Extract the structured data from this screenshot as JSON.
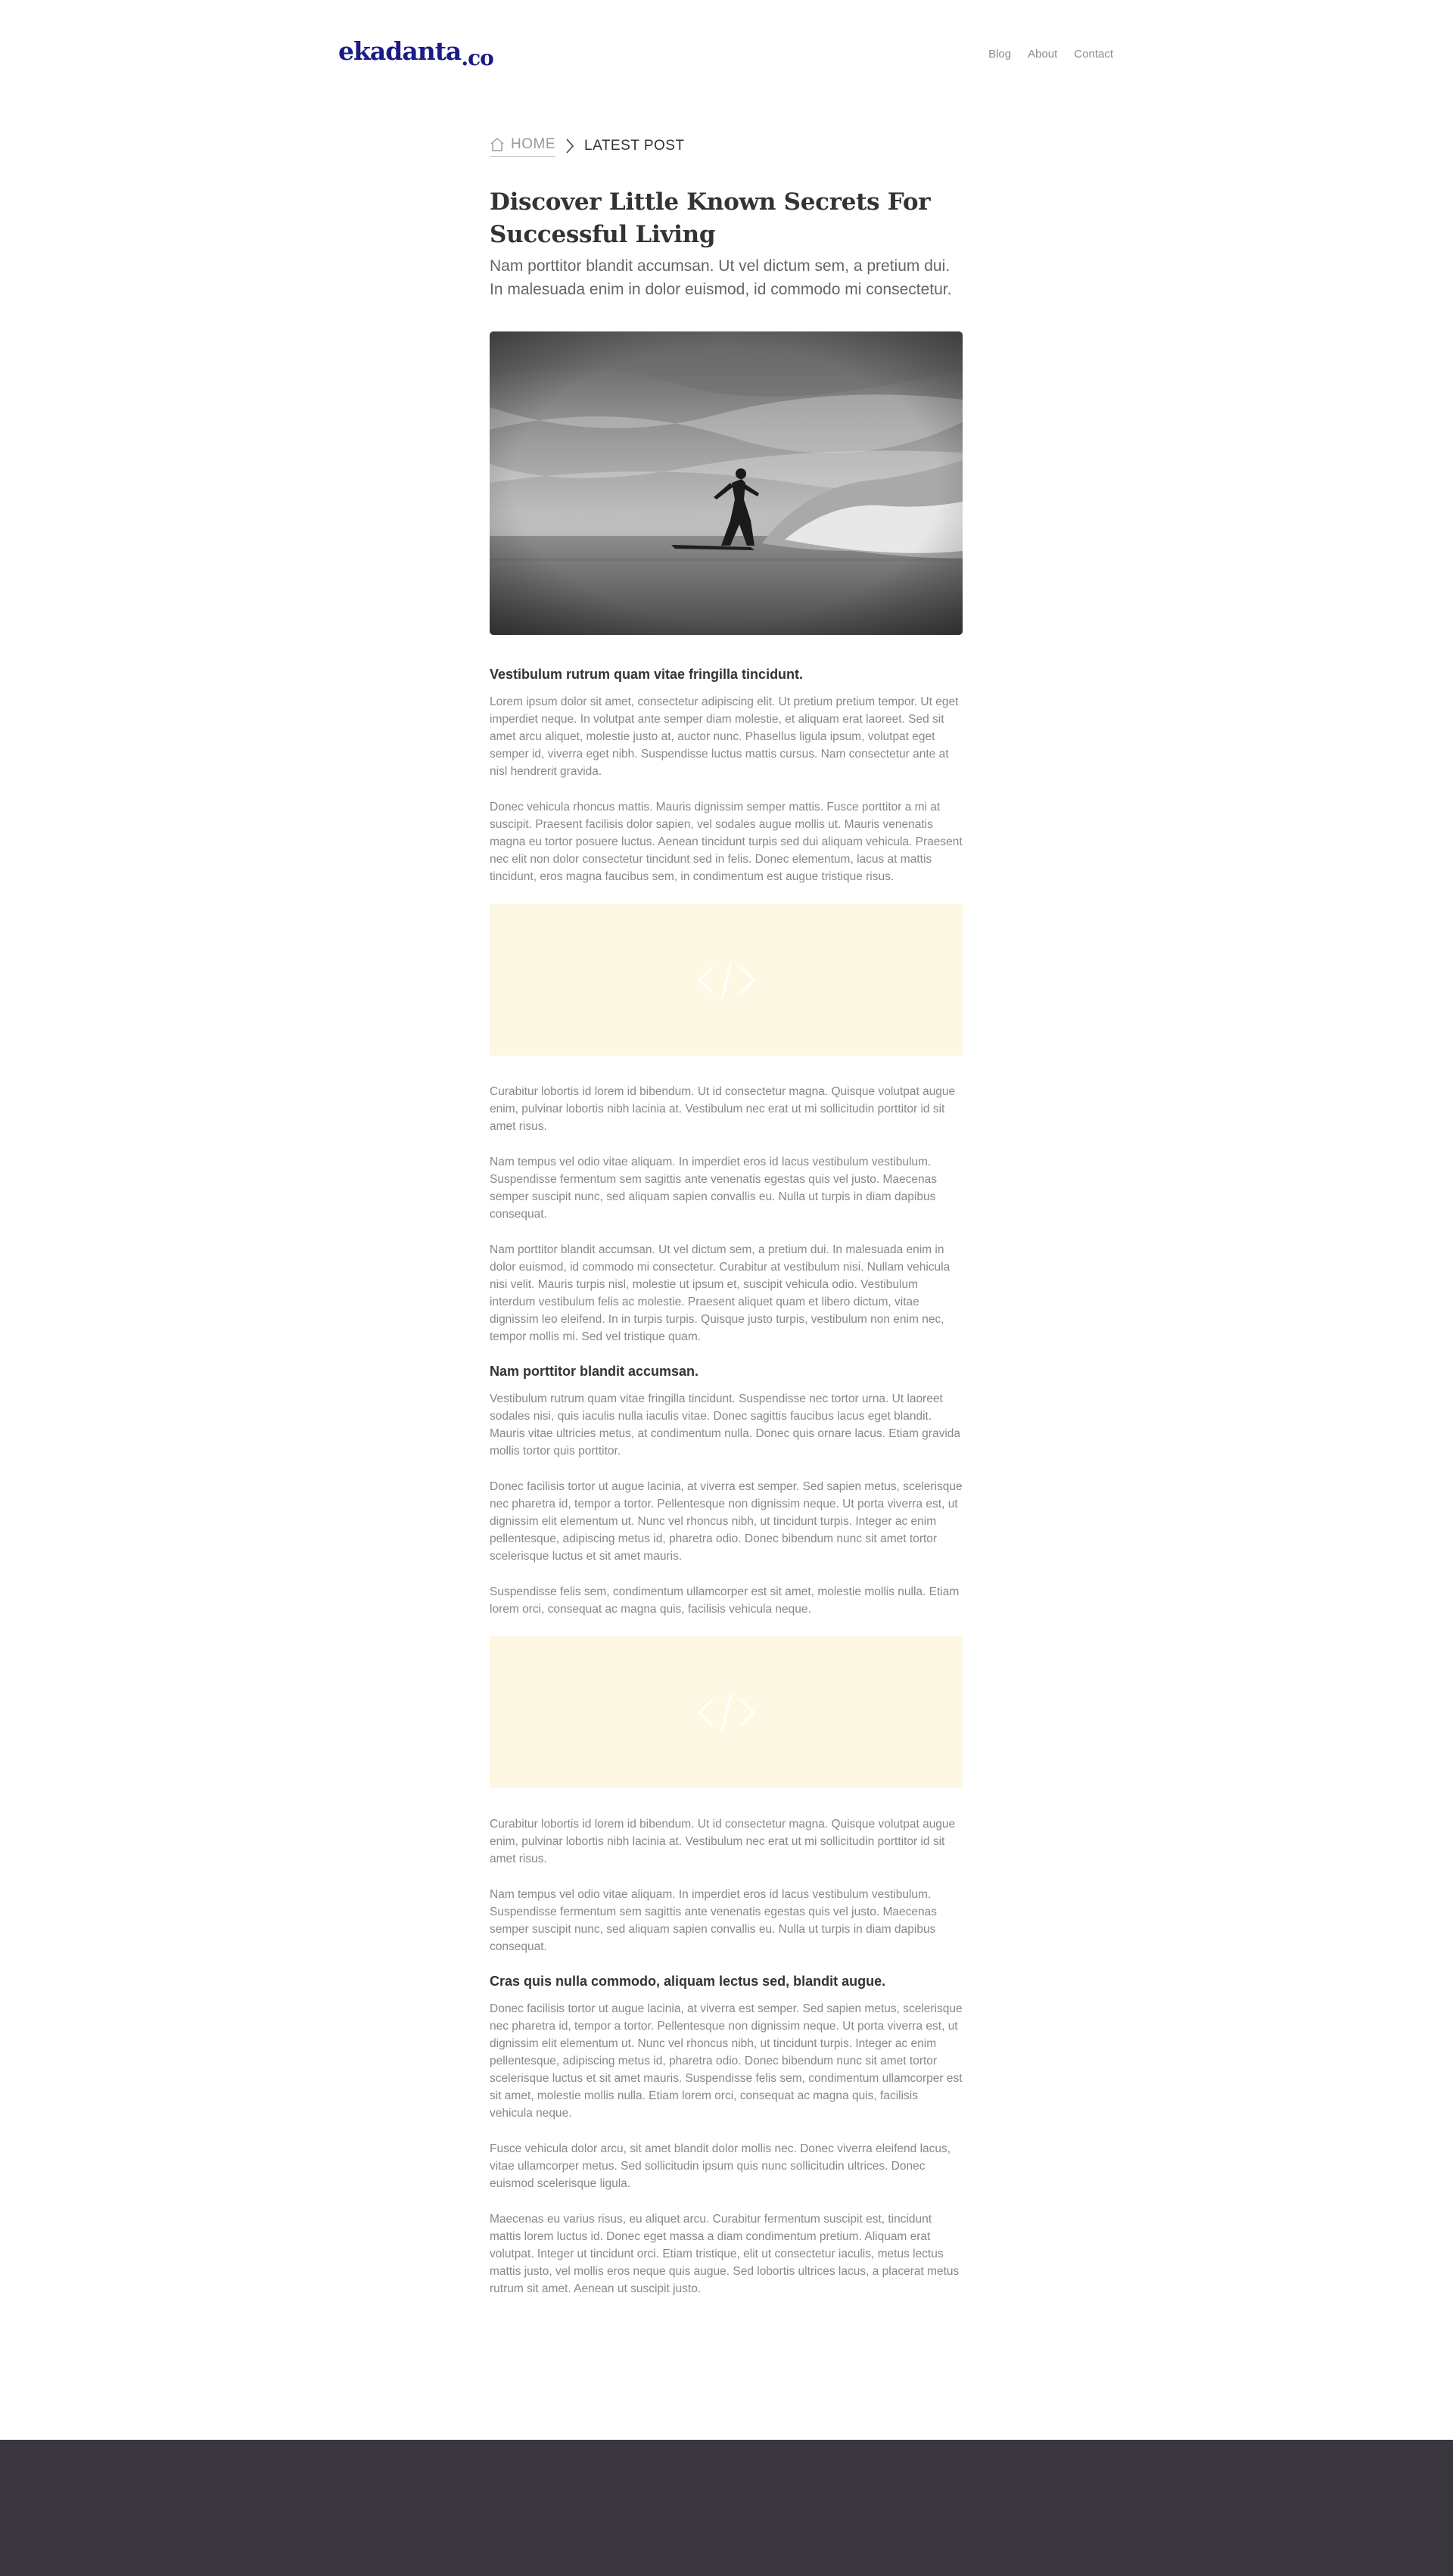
{
  "brand": {
    "logo_main": "ekadanta",
    "logo_tld": ".co"
  },
  "nav": {
    "items": [
      "Blog",
      "About",
      "Contact"
    ]
  },
  "breadcrumb": {
    "home": "HOME",
    "current": "LATEST POST"
  },
  "post": {
    "title": "Discover Little Known Secrets For Successful Living",
    "lead": "Nam porttitor blandit accumsan. Ut vel dictum sem, a pretium dui. In malesuada enim in dolor euismod, id commodo mi consectetur.",
    "section1": {
      "heading": "Vestibulum rutrum quam vitae fringilla tincidunt.",
      "paragraphs": [
        "Lorem ipsum dolor sit amet, consectetur adipiscing elit. Ut pretium pretium tempor. Ut eget imperdiet neque. In volutpat ante semper diam molestie, et aliquam erat laoreet. Sed sit amet arcu aliquet, molestie justo at, auctor nunc. Phasellus ligula ipsum, volutpat eget semper id, viverra eget nibh. Suspendisse luctus mattis cursus. Nam consectetur ante at nisl hendrerit gravida.",
        "Donec vehicula rhoncus mattis. Mauris dignissim semper mattis. Fusce porttitor a mi at suscipit. Praesent facilisis dolor sapien, vel sodales augue mollis ut. Mauris venenatis magna eu tortor posuere luctus. Aenean tincidunt turpis sed dui aliquam vehicula. Praesent nec elit non dolor consectetur tincidunt sed in felis. Donec elementum, lacus at mattis tincidunt, eros magna faucibus sem, in condimentum est augue tristique risus."
      ]
    },
    "section2": {
      "paragraphs": [
        "Curabitur lobortis id lorem id bibendum. Ut id consectetur magna. Quisque volutpat augue enim, pulvinar lobortis nibh lacinia at. Vestibulum nec erat ut mi sollicitudin porttitor id sit amet risus.",
        "Nam tempus vel odio vitae aliquam. In imperdiet eros id lacus vestibulum vestibulum. Suspendisse fermentum sem sagittis ante venenatis egestas quis vel justo. Maecenas semper suscipit nunc, sed aliquam sapien convallis eu. Nulla ut turpis in diam dapibus consequat.",
        "Nam porttitor blandit accumsan. Ut vel dictum sem, a pretium dui. In malesuada enim in dolor euismod, id commodo mi consectetur. Curabitur at vestibulum nisi. Nullam vehicula nisi velit. Mauris turpis nisl, molestie ut ipsum et, suscipit vehicula odio. Vestibulum interdum vestibulum felis ac molestie. Praesent aliquet quam et libero dictum, vitae dignissim leo eleifend. In in turpis turpis. Quisque justo turpis, vestibulum non enim nec, tempor mollis mi. Sed vel tristique quam."
      ]
    },
    "section3": {
      "heading": "Nam porttitor blandit accumsan.",
      "paragraphs": [
        "Vestibulum rutrum quam vitae fringilla tincidunt. Suspendisse nec tortor urna. Ut laoreet sodales nisi, quis iaculis nulla iaculis vitae. Donec sagittis faucibus lacus eget blandit. Mauris vitae ultricies metus, at condimentum nulla. Donec quis ornare lacus. Etiam gravida mollis tortor quis porttitor.",
        "Donec facilisis tortor ut augue lacinia, at viverra est semper. Sed sapien metus, scelerisque nec pharetra id, tempor a tortor. Pellentesque non dignissim neque. Ut porta viverra est, ut dignissim elit elementum ut. Nunc vel rhoncus nibh, ut tincidunt turpis. Integer ac enim pellentesque, adipiscing metus id, pharetra odio. Donec bibendum nunc sit amet tortor scelerisque luctus et sit amet mauris.",
        "Suspendisse felis sem, condimentum ullamcorper est sit amet, molestie mollis nulla. Etiam lorem orci, consequat ac magna quis, facilisis vehicula neque."
      ]
    },
    "section4": {
      "paragraphs": [
        "Curabitur lobortis id lorem id bibendum. Ut id consectetur magna. Quisque volutpat augue enim, pulvinar lobortis nibh lacinia at. Vestibulum nec erat ut mi sollicitudin porttitor id sit amet risus.",
        "Nam tempus vel odio vitae aliquam. In imperdiet eros id lacus vestibulum vestibulum. Suspendisse fermentum sem sagittis ante venenatis egestas quis vel justo. Maecenas semper suscipit nunc, sed aliquam sapien convallis eu. Nulla ut turpis in diam dapibus consequat."
      ]
    },
    "section5": {
      "heading": "Cras quis nulla commodo, aliquam lectus sed, blandit augue.",
      "paragraphs": [
        "Donec facilisis tortor ut augue lacinia, at viverra est semper. Sed sapien metus, scelerisque nec pharetra id, tempor a tortor. Pellentesque non dignissim neque. Ut porta viverra est, ut dignissim elit elementum ut. Nunc vel rhoncus nibh, ut tincidunt turpis. Integer ac enim pellentesque, adipiscing metus id, pharetra odio. Donec bibendum nunc sit amet tortor scelerisque luctus et sit amet mauris. Suspendisse felis sem, condimentum ullamcorper est sit amet, molestie mollis nulla. Etiam lorem orci, consequat ac magna quis, facilisis vehicula neque.",
        "Fusce vehicula dolor arcu, sit amet blandit dolor mollis nec. Donec viverra eleifend lacus, vitae ullamcorper metus. Sed sollicitudin ipsum quis nunc sollicitudin ultrices. Donec euismod scelerisque ligula.",
        "Maecenas eu varius risus, eu aliquet arcu. Curabitur fermentum suscipit est, tincidunt mattis lorem luctus id. Donec eget massa a diam condimentum pretium. Aliquam erat volutpat. Integer ut tincidunt orci. Etiam tristique, elit ut consectetur iaculis, metus lectus mattis justo, vel mollis eros neque quis augue. Sed lobortis ultrices lacus, a placerat metus rutrum sit amet. Aenean ut suscipit justo."
      ]
    }
  },
  "icons": {
    "home": "home-icon",
    "chevron": "chevron-right-icon",
    "embed": "code-icon"
  },
  "colors": {
    "brand": "#1b1c86",
    "embed_bg": "#fdf8e3",
    "footer_bg": "#39363d"
  }
}
